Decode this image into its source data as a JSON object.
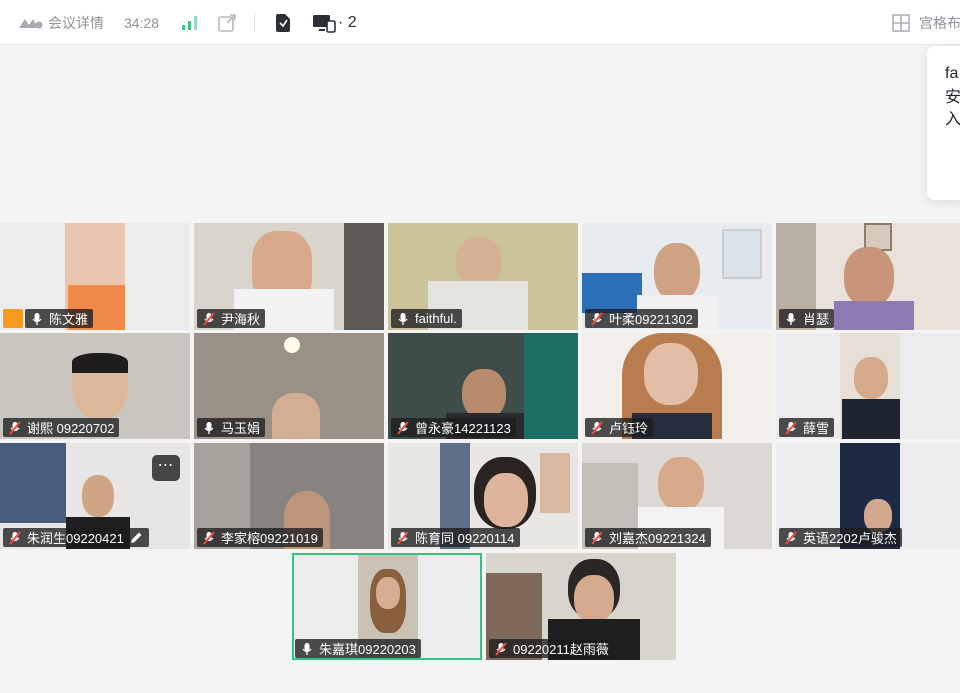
{
  "topbar": {
    "meeting_details": "会议详情",
    "timer": "34:28",
    "share_count": "· 2",
    "layout": "宫格布"
  },
  "popup": {
    "line1": "fa",
    "line2": "安",
    "line3": "入"
  },
  "participants": [
    {
      "name": "陈文雅",
      "muted": false
    },
    {
      "name": "尹海秋",
      "muted": true
    },
    {
      "name": "faithful.",
      "muted": false
    },
    {
      "name": "叶柔09221302",
      "muted": true
    },
    {
      "name": "肖瑟",
      "muted": false
    },
    {
      "name": "谢熙 09220702",
      "muted": true
    },
    {
      "name": "马玉娟",
      "muted": false
    },
    {
      "name": "曾永豪14221123",
      "muted": true
    },
    {
      "name": "卢钰玲",
      "muted": true
    },
    {
      "name": "薛雪",
      "muted": true
    },
    {
      "name": "朱润生09220421",
      "muted": true
    },
    {
      "name": "李家榕09221019",
      "muted": true
    },
    {
      "name": "陈育同 09220114",
      "muted": true
    },
    {
      "name": "刘嘉杰09221324",
      "muted": true
    },
    {
      "name": "英语2202卢骏杰",
      "muted": true
    },
    {
      "name": "朱嘉琪09220203",
      "muted": false
    },
    {
      "name": "09220211赵雨薇",
      "muted": true
    }
  ],
  "colors": {
    "active_speaker": "#2fc482",
    "host_badge": "#f79a1e",
    "mic_muted": "#f04a3e"
  }
}
